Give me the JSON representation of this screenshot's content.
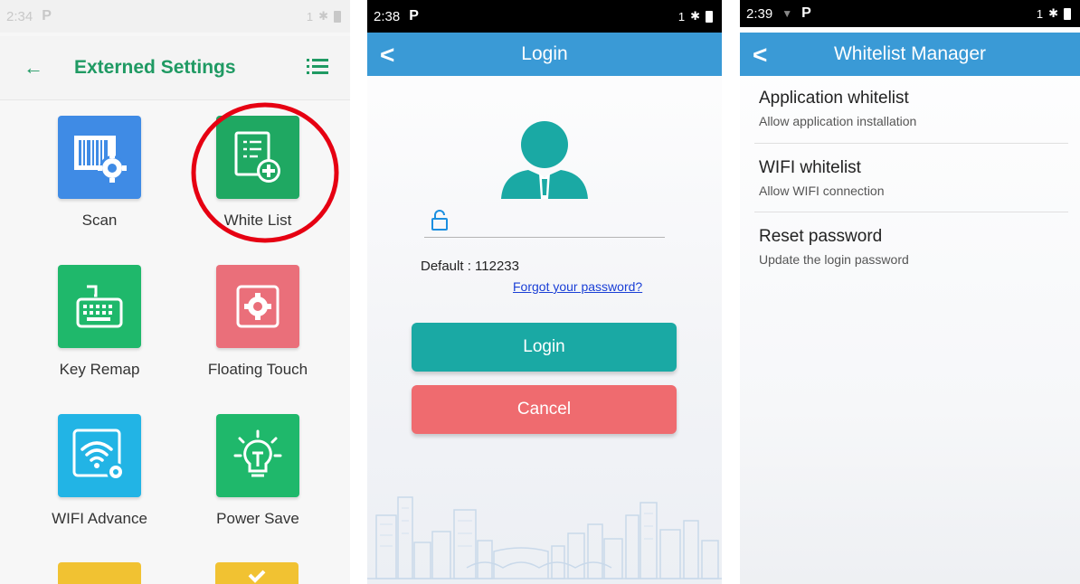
{
  "screen1": {
    "status_time": "2:34",
    "status_app_icon": "P",
    "status_right": "1",
    "title": "Externed Settings",
    "items": [
      {
        "label": "Scan",
        "icon": "barcode-gear-icon",
        "color": "#3f8be5"
      },
      {
        "label": "White List",
        "icon": "list-plus-icon",
        "color": "#1fa862"
      },
      {
        "label": "Key Remap",
        "icon": "keyboard-icon",
        "color": "#1fb86b"
      },
      {
        "label": "Floating Touch",
        "icon": "gear-box-icon",
        "color": "#ea6f7a"
      },
      {
        "label": "WIFI Advance",
        "icon": "wifi-gear-icon",
        "color": "#22b4e5"
      },
      {
        "label": "Power Save",
        "icon": "lightbulb-icon",
        "color": "#1fb86b"
      }
    ],
    "highlight_color": "#e60012"
  },
  "screen2": {
    "status_time": "2:38",
    "status_app_icon": "P",
    "status_right": "1",
    "title": "Login",
    "password_placeholder": "",
    "default_text": "Default : 112233",
    "forgot_link": "Forgot your password?",
    "login_button": "Login",
    "cancel_button": "Cancel",
    "colors": {
      "header": "#3a9ad6",
      "login": "#1aa9a4",
      "cancel": "#ef6b6f",
      "avatar": "#1aa9a4",
      "link": "#1a3fd6"
    }
  },
  "screen3": {
    "status_time": "2:39",
    "status_app_icon": "P",
    "status_right": "1",
    "title": "Whitelist Manager",
    "rows": [
      {
        "title": "Application whitelist",
        "subtitle": "Allow application installation"
      },
      {
        "title": "WIFI whitelist",
        "subtitle": "Allow WIFI connection"
      },
      {
        "title": "Reset password",
        "subtitle": "Update the login password"
      }
    ]
  }
}
